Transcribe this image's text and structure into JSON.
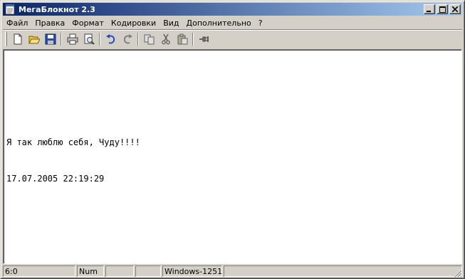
{
  "window": {
    "title": "МегаБлокнот 2.3"
  },
  "caption_buttons": {
    "minimize": "_",
    "maximize": "□",
    "close": "✕"
  },
  "menu": [
    {
      "label": "Файл"
    },
    {
      "label": "Правка"
    },
    {
      "label": "Формат"
    },
    {
      "label": "Кодировки"
    },
    {
      "label": "Вид"
    },
    {
      "label": "Дополнительно"
    },
    {
      "label": "?"
    }
  ],
  "toolbar": {
    "icons": [
      "new-file-icon",
      "open-folder-icon",
      "save-icon",
      "print-icon",
      "print-preview-icon",
      "undo-icon",
      "redo-icon",
      "copy-icon",
      "cut-icon",
      "paste-icon",
      "pin-icon"
    ]
  },
  "editor": {
    "lines": [
      "Я так люблю себя, Чуду!!!!",
      "17.07.2005 22:19:29"
    ]
  },
  "statusbar": {
    "position": "6:0",
    "num": "Num",
    "panel3": "",
    "panel4": "",
    "encoding": "Windows-1251",
    "panel6": ""
  },
  "colors": {
    "titlebar_start": "#0a246a",
    "titlebar_end": "#a6caf0",
    "face": "#d4d0c8"
  }
}
